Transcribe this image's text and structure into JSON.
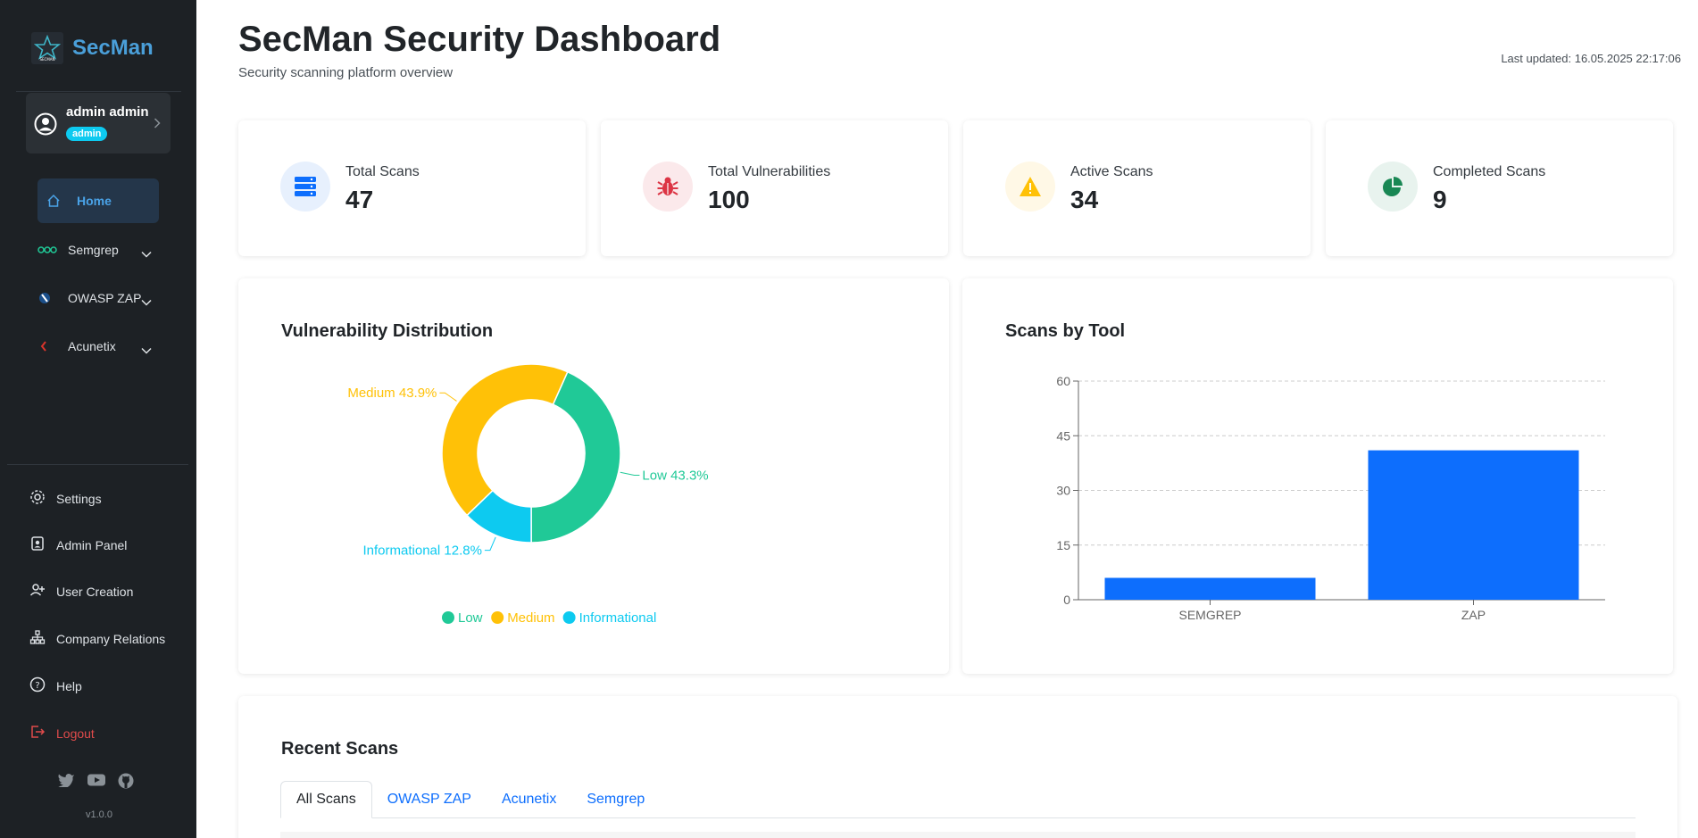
{
  "brand": {
    "name": "SecMan",
    "logo_text": "SECMAN"
  },
  "user": {
    "name": "admin admin",
    "role": "admin"
  },
  "nav": [
    {
      "label": "Home",
      "icon": "home-icon",
      "active": true
    },
    {
      "label": "Semgrep",
      "icon": "semgrep-icon",
      "expandable": true
    },
    {
      "label": "OWASP ZAP",
      "icon": "zap-icon",
      "expandable": true
    },
    {
      "label": "Acunetix",
      "icon": "acunetix-icon",
      "expandable": true
    }
  ],
  "sidebar_links": [
    {
      "label": "Settings",
      "icon": "gear-icon"
    },
    {
      "label": "Admin Panel",
      "icon": "admin-badge-icon"
    },
    {
      "label": "User Creation",
      "icon": "user-plus-icon"
    },
    {
      "label": "Company Relations",
      "icon": "org-chart-icon"
    },
    {
      "label": "Help",
      "icon": "help-icon"
    },
    {
      "label": "Logout",
      "icon": "logout-icon"
    }
  ],
  "socials": [
    "twitter-icon",
    "youtube-icon",
    "github-icon"
  ],
  "version": "v1.0.0",
  "header": {
    "title": "SecMan Security Dashboard",
    "subtitle": "Security scanning platform overview",
    "last_updated": "Last updated: 16.05.2025 22:17:06"
  },
  "stats": [
    {
      "label": "Total Scans",
      "value": "47",
      "icon": "server-icon",
      "color": "#0d6efd",
      "bg": "#e7f0fd"
    },
    {
      "label": "Total Vulnerabilities",
      "value": "100",
      "icon": "bug-icon",
      "color": "#dc3545",
      "bg": "#fbe9eb"
    },
    {
      "label": "Active Scans",
      "value": "34",
      "icon": "warning-icon",
      "color": "#ffc107",
      "bg": "#fff8e6"
    },
    {
      "label": "Completed Scans",
      "value": "9",
      "icon": "pie-chart-icon",
      "color": "#198754",
      "bg": "#e8f3ee"
    }
  ],
  "charts": {
    "vuln_title": "Vulnerability Distribution",
    "tool_title": "Scans by Tool"
  },
  "chart_data": [
    {
      "type": "pie",
      "title": "Vulnerability Distribution",
      "donut": true,
      "slices": [
        {
          "label": "Low",
          "value": 43.3,
          "display": "Low 43.3%",
          "color": "#20c997"
        },
        {
          "label": "Informational",
          "value": 12.8,
          "display": "Informational 12.8%",
          "color": "#0dcaf0"
        },
        {
          "label": "Medium",
          "value": 43.9,
          "display": "Medium 43.9%",
          "color": "#ffc107"
        }
      ],
      "legend": [
        "Low",
        "Medium",
        "Informational"
      ],
      "legend_position": "bottom"
    },
    {
      "type": "bar",
      "title": "Scans by Tool",
      "categories": [
        "SEMGREP",
        "ZAP"
      ],
      "values": [
        6,
        41
      ],
      "ylim": [
        0,
        60
      ],
      "yticks": [
        "0",
        "15",
        "30",
        "45",
        "60"
      ],
      "grid": true,
      "color": "#0d6efd"
    }
  ],
  "recent": {
    "title": "Recent Scans",
    "tabs": [
      "All Scans",
      "OWASP ZAP",
      "Acunetix",
      "Semgrep"
    ]
  }
}
